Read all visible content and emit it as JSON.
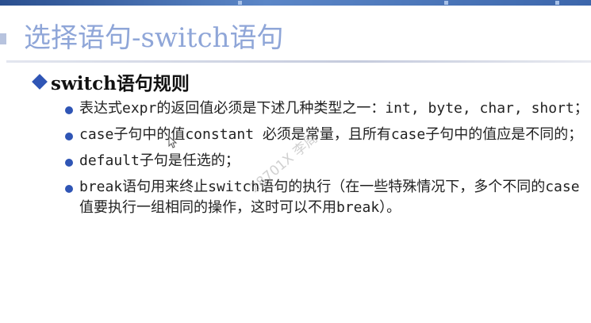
{
  "slide": {
    "title": "选择语句-switch语句",
    "heading": "switch语句规则",
    "rules": [
      "表达式expr的返回值必须是下述几种类型之一：int, byte, char, short；",
      "case子句中的值constant 必须是常量，且所有case子句中的值应是不同的；",
      "default子句是任选的；",
      "break语句用来终止switch语句的执行（在一些特殊情况下，多个不同的case值要执行一组相同的操作，这时可以不用break）。"
    ]
  },
  "watermark": "28701X 李周",
  "colors": {
    "title": "#8fa6d8",
    "bullet": "#2f55b5",
    "text": "#222222"
  },
  "icons": {
    "heading_marker": "diamond-icon",
    "rule_marker": "bullet-icon",
    "pointer": "mouse-cursor-icon"
  }
}
